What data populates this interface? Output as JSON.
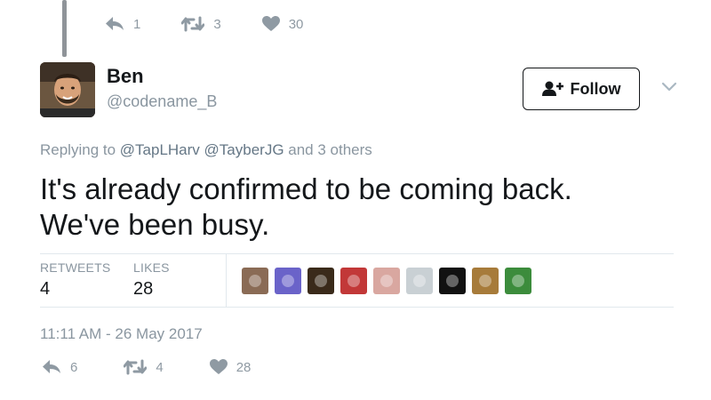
{
  "prev_tweet": {
    "replies": "1",
    "retweets": "3",
    "likes": "30"
  },
  "tweet": {
    "author_name": "Ben",
    "author_handle": "@codename_B",
    "follow_label": "Follow",
    "replying_prefix": "Replying to ",
    "replying_users": [
      "@TapLHarv",
      "@TayberJG"
    ],
    "replying_suffix": " and 3 others",
    "text_line1": "It's already confirmed to be coming back.",
    "text_line2": "We've been busy.",
    "timestamp": "11:11 AM - 26 May 2017"
  },
  "stats": {
    "retweets_label": "RETWEETS",
    "retweets_value": "4",
    "likes_label": "LIKES",
    "likes_value": "28"
  },
  "likers": [
    "#8a6b55",
    "#6a63c9",
    "#3a2a1a",
    "#c23838",
    "#d9a7a0",
    "#c9d0d4",
    "#111111",
    "#a77b3a",
    "#3c8c3c"
  ],
  "bottom_actions": {
    "replies": "6",
    "retweets": "4",
    "likes": "28"
  },
  "icons": [
    "reply-icon",
    "retweet-icon",
    "heart-icon",
    "add-user-icon",
    "chevron-down-icon"
  ]
}
